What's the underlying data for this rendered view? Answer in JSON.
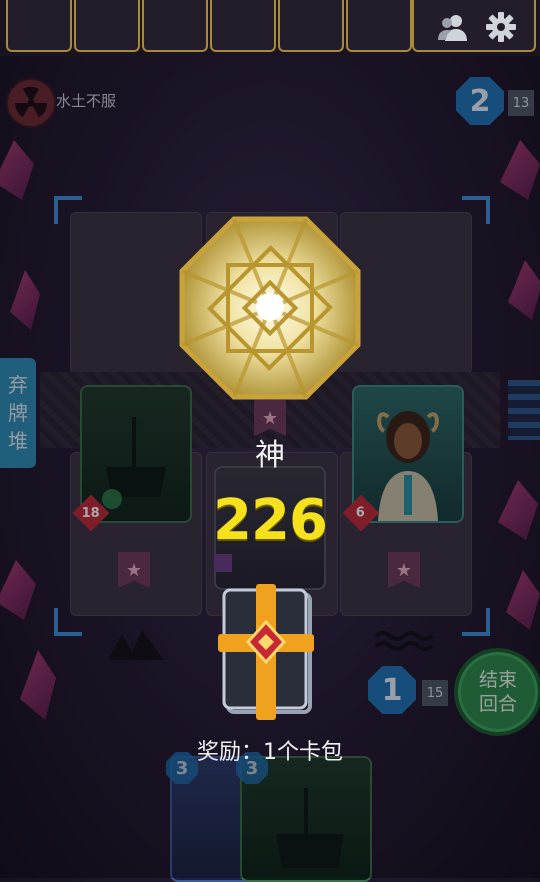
{
  "status_bar": {
    "left_text": "",
    "right_text": ""
  },
  "opponent": {
    "effect_label": "水土不服",
    "energy": "2",
    "deck_count": "13"
  },
  "player": {
    "energy": "1",
    "deck_count": "15",
    "hand_costs": [
      "3",
      "3"
    ]
  },
  "board": {
    "left_card_damage": "18",
    "right_card_damage": "6"
  },
  "buttons": {
    "discard_pile": [
      "弃",
      "牌",
      "堆"
    ],
    "end_turn": [
      "结束",
      "回合"
    ]
  },
  "result": {
    "rank_title": "神",
    "score": "226",
    "reward_text": "奖励：1个卡包"
  },
  "colors": {
    "score": "#f5e21d",
    "energy_badge": "#1e73b4",
    "end_turn": "#2c8a4a",
    "damage": "#c02a3b"
  },
  "icons": [
    "radiation-icon",
    "friends-icon",
    "gear-icon",
    "star-icon",
    "octagon-emblem-icon",
    "card-pack-icon"
  ]
}
